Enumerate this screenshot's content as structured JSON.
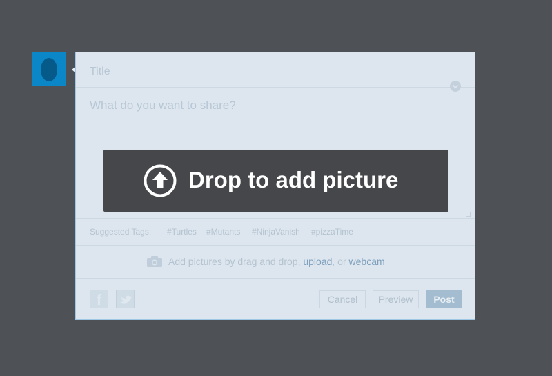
{
  "composer": {
    "title_placeholder": "Title",
    "body_placeholder": "What do you want to share?"
  },
  "tags": {
    "label": "Suggested Tags:",
    "items": [
      "#Turtles",
      "#Mutants",
      "#NinjaVanish",
      "#pizzaTime"
    ]
  },
  "upload": {
    "text_before": "Add pictures by drag and drop,",
    "upload_link": "upload",
    "or_text": ", or",
    "webcam_link": "webcam"
  },
  "footer": {
    "facebook_glyph": "f",
    "cancel_label": "Cancel",
    "preview_label": "Preview",
    "post_label": "Post"
  },
  "drop_overlay": {
    "text": "Drop to add picture"
  },
  "icons": {
    "avatar": "user-silhouette-icon",
    "options": "chevron-down-icon",
    "camera": "camera-icon",
    "facebook": "facebook-icon",
    "twitter": "twitter-icon",
    "upload": "upload-arrow-icon"
  },
  "colors": {
    "background": "#4e5156",
    "accent": "#0b86c6",
    "overlay": "#45474a",
    "post_button": "#a3bccf"
  }
}
